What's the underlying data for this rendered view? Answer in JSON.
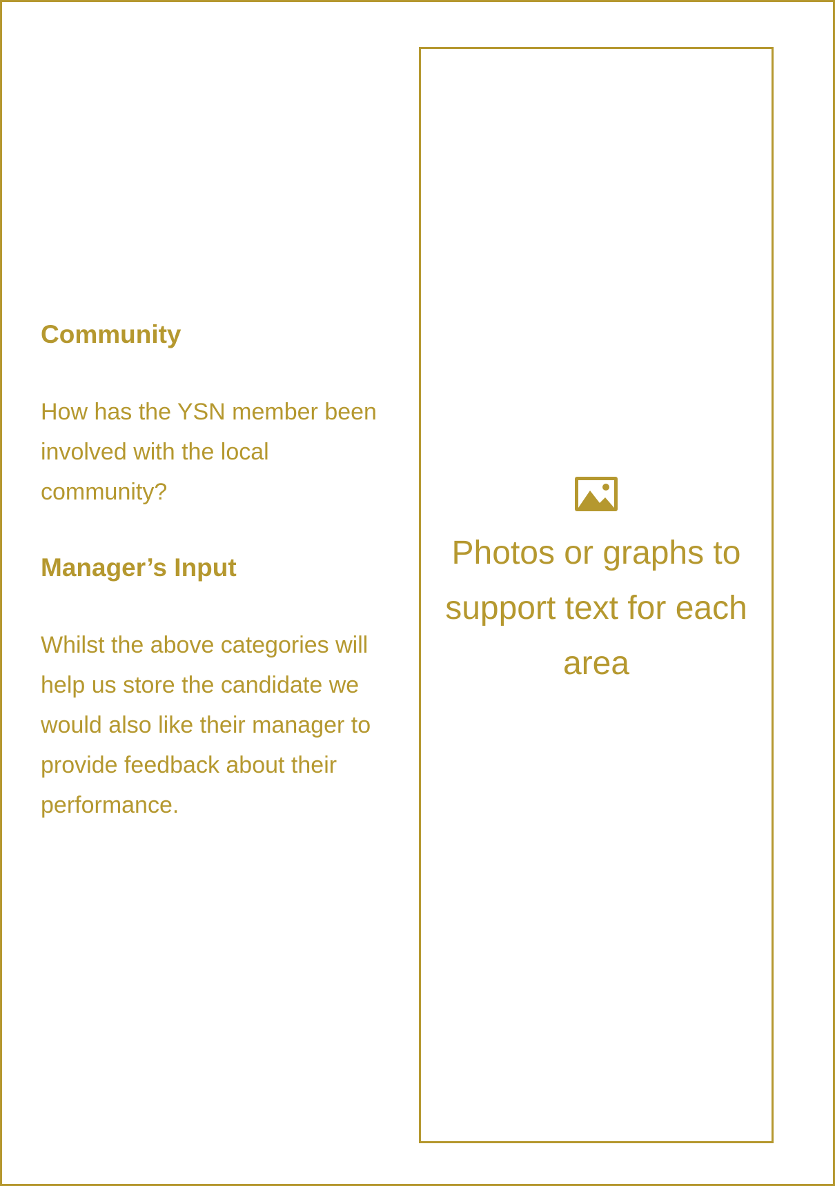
{
  "community": {
    "heading": "Community",
    "body": "How has the YSN member been involved with the local community?"
  },
  "manager_input": {
    "heading": "Manager’s Input",
    "body": "Whilst the above categories will help us store the candidate we would also like their manager to provide feedback about their performance."
  },
  "placeholder": {
    "icon": "picture-icon",
    "caption": "Photos or graphs to support text for each area"
  },
  "colors": {
    "accent": "#B5982F",
    "background": "#FFFFFF"
  }
}
